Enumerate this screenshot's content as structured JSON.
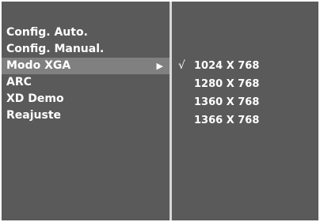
{
  "menu": {
    "items": [
      {
        "label": "Config. Auto.",
        "active": false
      },
      {
        "label": "Config. Manual.",
        "active": false
      },
      {
        "label": "Modo XGA",
        "active": true,
        "arrow": "▶"
      },
      {
        "label": "ARC",
        "active": false
      },
      {
        "label": "XD Demo",
        "active": false
      },
      {
        "label": "Reajuste",
        "active": false
      }
    ]
  },
  "submenu": {
    "check_mark": "√",
    "options": [
      {
        "label": "1024 X 768",
        "selected": true
      },
      {
        "label": "1280 X 768",
        "selected": false
      },
      {
        "label": "1360 X 768",
        "selected": false
      },
      {
        "label": "1366 X 768",
        "selected": false
      }
    ]
  },
  "colors": {
    "panel": "#5a5a5a",
    "highlight": "#808080",
    "divider": "#d8d8d8",
    "text": "#ffffff"
  }
}
